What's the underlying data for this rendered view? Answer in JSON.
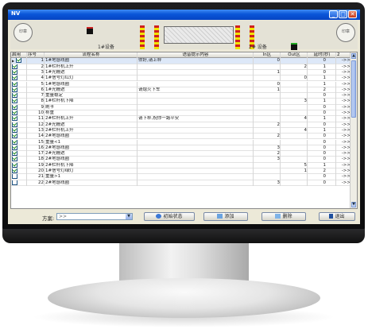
{
  "window": {
    "title": "NV"
  },
  "header": {
    "seal_left": "印章",
    "seal_right": "印章",
    "lane_left": "1#设备",
    "lane_right": "2# 设备"
  },
  "table": {
    "columns": [
      "启用",
      "序号",
      "流程名称",
      "语音提示内容",
      "In区",
      "Out区",
      "延时(秒)",
      "2"
    ],
    "rows": [
      {
        "on": true,
        "no": "1",
        "name": "1#地感线圈",
        "voice": "你好,请上秤",
        "in": "0",
        "out": "",
        "delay": "0",
        "go": "->>"
      },
      {
        "on": true,
        "no": "2",
        "name": "1#栏杆机上升",
        "voice": "",
        "in": "",
        "out": "2",
        "delay": "1",
        "go": "->>"
      },
      {
        "on": true,
        "no": "3",
        "name": "1#光栅遮",
        "voice": "",
        "in": "1",
        "out": "",
        "delay": "0",
        "go": "->>"
      },
      {
        "on": true,
        "no": "4",
        "name": "1#信号灯红灯",
        "voice": "",
        "in": "",
        "out": "0",
        "delay": "1",
        "go": "->>"
      },
      {
        "on": true,
        "no": "5",
        "name": "1#地感线圈",
        "voice": "",
        "in": "0",
        "out": "",
        "delay": "1",
        "go": "->>"
      },
      {
        "on": true,
        "no": "6",
        "name": "1#光栅遮",
        "voice": "请熄火下车",
        "in": "1",
        "out": "",
        "delay": "2",
        "go": "->>"
      },
      {
        "on": true,
        "no": "7",
        "name": "重量稳定",
        "voice": "",
        "in": "",
        "out": "",
        "delay": "0",
        "go": "->>"
      },
      {
        "on": true,
        "no": "8",
        "name": "1#栏杆机下降",
        "voice": "",
        "in": "",
        "out": "3",
        "delay": "1",
        "go": "->>"
      },
      {
        "on": true,
        "no": "9",
        "name": "刷卡",
        "voice": "",
        "in": "",
        "out": "",
        "delay": "0",
        "go": "->>"
      },
      {
        "on": true,
        "no": "10",
        "name": "称重",
        "voice": "",
        "in": "",
        "out": "",
        "delay": "0",
        "go": "->>"
      },
      {
        "on": true,
        "no": "11",
        "name": "2#栏杆机上升",
        "voice": "请下秤,祝你一路平安",
        "in": "",
        "out": "4",
        "delay": "1",
        "go": "->>"
      },
      {
        "on": true,
        "no": "12",
        "name": "2#光栅遮",
        "voice": "",
        "in": "2",
        "out": "",
        "delay": "0",
        "go": "->>"
      },
      {
        "on": true,
        "no": "13",
        "name": "2#栏杆机上升",
        "voice": "",
        "in": "",
        "out": "4",
        "delay": "1",
        "go": "->>"
      },
      {
        "on": true,
        "no": "14",
        "name": "2#地感线圈",
        "voice": "",
        "in": "2",
        "out": "",
        "delay": "0",
        "go": "->>"
      },
      {
        "on": true,
        "no": "15",
        "name": "重量<1",
        "voice": "",
        "in": "",
        "out": "",
        "delay": "0",
        "go": "->>"
      },
      {
        "on": true,
        "no": "16",
        "name": "2#地感线圈",
        "voice": "",
        "in": "3",
        "out": "",
        "delay": "0",
        "go": "->>"
      },
      {
        "on": true,
        "no": "17",
        "name": "2#光栅遮",
        "voice": "",
        "in": "2",
        "out": "",
        "delay": "0",
        "go": "->>"
      },
      {
        "on": true,
        "no": "18",
        "name": "2#地感线圈",
        "voice": "",
        "in": "3",
        "out": "",
        "delay": "0",
        "go": "->>"
      },
      {
        "on": true,
        "no": "19",
        "name": "2#栏杆机下降",
        "voice": "",
        "in": "",
        "out": "5",
        "delay": "1",
        "go": "->>"
      },
      {
        "on": true,
        "no": "20",
        "name": "1#信号灯绿灯",
        "voice": "",
        "in": "",
        "out": "1",
        "delay": "2",
        "go": "->>"
      },
      {
        "on": false,
        "no": "21",
        "name": "重量>1",
        "voice": "",
        "in": "",
        "out": "",
        "delay": "0",
        "go": "->>"
      },
      {
        "on": false,
        "no": "22",
        "name": "2#地感线圈",
        "voice": "",
        "in": "3",
        "out": "",
        "delay": "0",
        "go": "->>"
      }
    ]
  },
  "toolbar": {
    "scheme_label": "方案:",
    "scheme_value": ">>",
    "init_label": "初始状态",
    "add_label": "添加",
    "delete_label": "删除",
    "exit_label": "退出"
  },
  "colors": {
    "titlebar": "#0a55d8",
    "check": "#1a8d1a",
    "selected_row": "#dde8f8"
  }
}
